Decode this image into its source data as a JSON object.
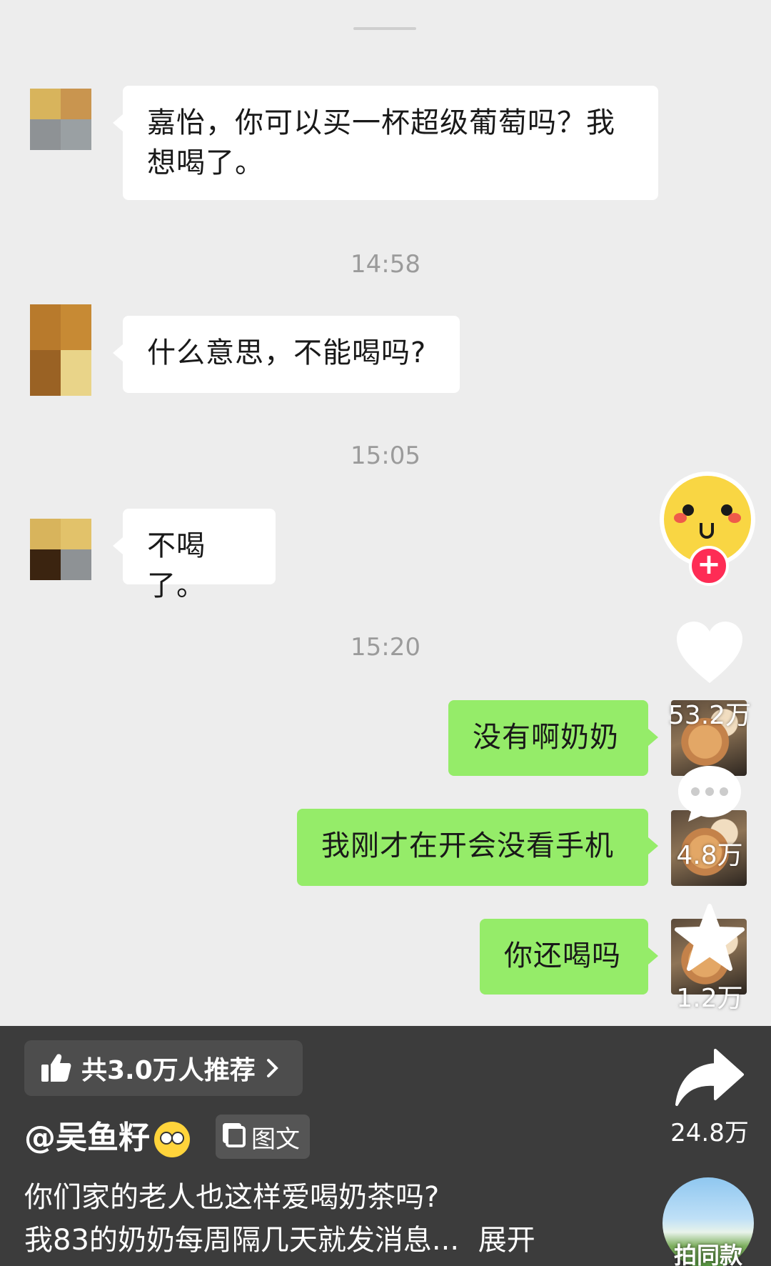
{
  "chat": {
    "messages": [
      {
        "side": "left",
        "text": "嘉怡，你可以买一杯超级葡萄吗？我想喝了。"
      },
      {
        "side": "left",
        "text": "什么意思，不能喝吗?"
      },
      {
        "side": "left",
        "text": "不喝了。"
      },
      {
        "side": "right",
        "text": "没有啊奶奶"
      },
      {
        "side": "right",
        "text": "我刚才在开会没看手机"
      },
      {
        "side": "right",
        "text": "你还喝吗"
      }
    ],
    "timestamps": [
      "14:58",
      "15:05",
      "15:20"
    ]
  },
  "sidebar": {
    "like_count": "53.2万",
    "comment_count": "4.8万",
    "favorite_count": "1.2万",
    "share_count": "24.8万",
    "follow_symbol": "+",
    "music_label": "拍同款"
  },
  "bottom": {
    "recommend_label": "共3.0万人推荐",
    "author": "@吴鱼籽",
    "tag_label": "图文",
    "desc_line1": "你们家的老人也这样爱喝奶茶吗?",
    "desc_line2": "我83的奶奶每周隔几天就发消息...",
    "expand_label": "展开"
  },
  "colors": {
    "chat_bg": "#ededed",
    "bubble_right": "#95ec69",
    "bubble_left": "#ffffff",
    "bottom_bar": "#3c3c3c",
    "follow_red": "#fe2c55"
  }
}
